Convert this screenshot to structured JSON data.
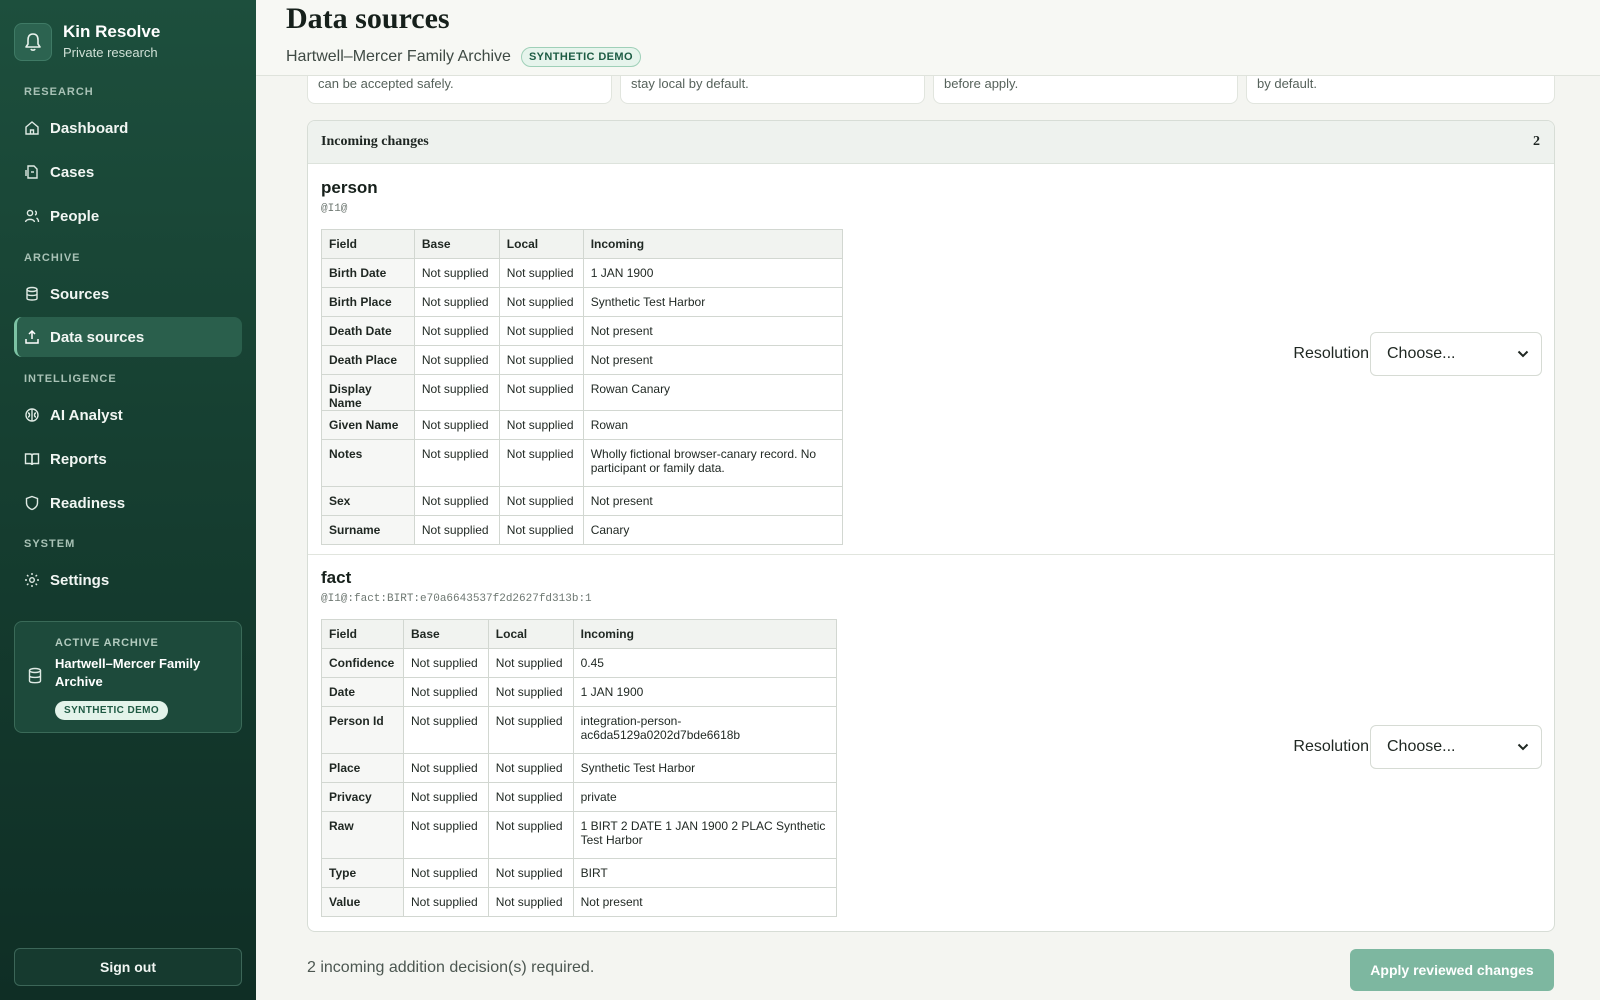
{
  "brand": {
    "name": "Kin Resolve",
    "subtitle": "Private research",
    "icon": "bell-icon"
  },
  "nav": {
    "sections": [
      {
        "label": "RESEARCH",
        "items": [
          {
            "label": "Dashboard",
            "icon": "home-icon"
          },
          {
            "label": "Cases",
            "icon": "document-icon"
          },
          {
            "label": "People",
            "icon": "people-icon"
          }
        ]
      },
      {
        "label": "ARCHIVE",
        "items": [
          {
            "label": "Sources",
            "icon": "database-icon"
          },
          {
            "label": "Data sources",
            "icon": "upload-icon",
            "active": true
          }
        ]
      },
      {
        "label": "INTELLIGENCE",
        "items": [
          {
            "label": "AI Analyst",
            "icon": "brain-icon"
          },
          {
            "label": "Reports",
            "icon": "book-icon"
          },
          {
            "label": "Readiness",
            "icon": "shield-icon"
          }
        ]
      },
      {
        "label": "SYSTEM",
        "items": [
          {
            "label": "Settings",
            "icon": "gear-icon"
          }
        ]
      }
    ]
  },
  "active_archive": {
    "label": "ACTIVE ARCHIVE",
    "name": "Hartwell–Mercer Family Archive",
    "badge": "SYNTHETIC DEMO"
  },
  "sign_out": "Sign out",
  "header": {
    "title": "Data sources",
    "archive": "Hartwell–Mercer Family Archive",
    "badge": "SYNTHETIC DEMO"
  },
  "summary_cards": [
    {
      "text": "can be accepted safely."
    },
    {
      "text": "stay local by default."
    },
    {
      "text": "before apply."
    },
    {
      "text": "by default."
    }
  ],
  "incoming": {
    "title": "Incoming changes",
    "count": "2",
    "columns": [
      "Field",
      "Base",
      "Local",
      "Incoming"
    ],
    "entities": [
      {
        "type": "person",
        "id": "@I1@",
        "rows": [
          {
            "field": "Birth Date",
            "base": "Not supplied",
            "local": "Not supplied",
            "incoming": "1 JAN 1900"
          },
          {
            "field": "Birth Place",
            "base": "Not supplied",
            "local": "Not supplied",
            "incoming": "Synthetic Test Harbor"
          },
          {
            "field": "Death Date",
            "base": "Not supplied",
            "local": "Not supplied",
            "incoming": "Not present"
          },
          {
            "field": "Death Place",
            "base": "Not supplied",
            "local": "Not supplied",
            "incoming": "Not present"
          },
          {
            "field": "Display Name",
            "base": "Not supplied",
            "local": "Not supplied",
            "incoming": "Rowan Canary"
          },
          {
            "field": "Given Name",
            "base": "Not supplied",
            "local": "Not supplied",
            "incoming": "Rowan"
          },
          {
            "field": "Notes",
            "base": "Not supplied",
            "local": "Not supplied",
            "incoming": "Wholly fictional browser-canary record. No participant or family data."
          },
          {
            "field": "Sex",
            "base": "Not supplied",
            "local": "Not supplied",
            "incoming": "Not present"
          },
          {
            "field": "Surname",
            "base": "Not supplied",
            "local": "Not supplied",
            "incoming": "Canary"
          }
        ],
        "resolution_label": "Resolution",
        "resolution_value": "Choose..."
      },
      {
        "type": "fact",
        "id": "@I1@:fact:BIRT:e70a6643537f2d2627fd313b:1",
        "rows": [
          {
            "field": "Confidence",
            "base": "Not supplied",
            "local": "Not supplied",
            "incoming": "0.45"
          },
          {
            "field": "Date",
            "base": "Not supplied",
            "local": "Not supplied",
            "incoming": "1 JAN 1900"
          },
          {
            "field": "Person Id",
            "base": "Not supplied",
            "local": "Not supplied",
            "incoming": "integration-person-ac6da5129a0202d7bde6618b"
          },
          {
            "field": "Place",
            "base": "Not supplied",
            "local": "Not supplied",
            "incoming": "Synthetic Test Harbor"
          },
          {
            "field": "Privacy",
            "base": "Not supplied",
            "local": "Not supplied",
            "incoming": "private"
          },
          {
            "field": "Raw",
            "base": "Not supplied",
            "local": "Not supplied",
            "incoming": "1 BIRT 2 DATE 1 JAN 1900 2 PLAC Synthetic Test Harbor"
          },
          {
            "field": "Type",
            "base": "Not supplied",
            "local": "Not supplied",
            "incoming": "BIRT"
          },
          {
            "field": "Value",
            "base": "Not supplied",
            "local": "Not supplied",
            "incoming": "Not present"
          }
        ],
        "resolution_label": "Resolution",
        "resolution_value": "Choose..."
      }
    ]
  },
  "footer": {
    "status": "2 incoming addition decision(s) required.",
    "apply_label": "Apply reviewed changes"
  },
  "colors": {
    "sidebar": "#163f31",
    "accent": "#7db7a0",
    "badge_bg": "#e6f4ec"
  }
}
